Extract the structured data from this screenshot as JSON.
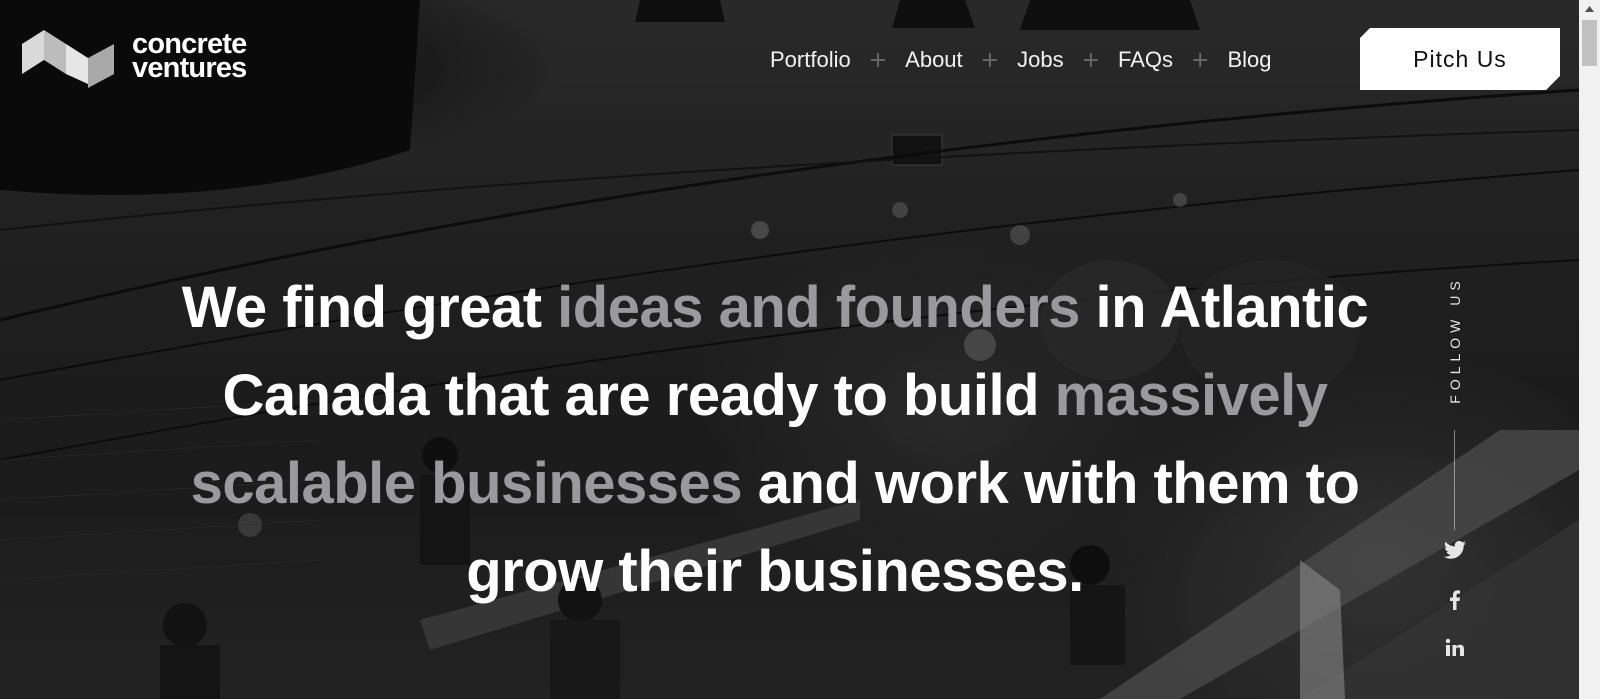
{
  "brand": {
    "name_line1": "concrete",
    "name_line2": "ventures"
  },
  "nav": {
    "items": [
      {
        "label": "Portfolio"
      },
      {
        "label": "About"
      },
      {
        "label": "Jobs"
      },
      {
        "label": "FAQs"
      },
      {
        "label": "Blog"
      }
    ],
    "separator": "+",
    "cta_label": "Pitch Us"
  },
  "hero": {
    "headline_parts": [
      {
        "text": "We find great ",
        "muted": false
      },
      {
        "text": "ideas and founders",
        "muted": true
      },
      {
        "text": " in Atlantic Canada that are ready to build ",
        "muted": false
      },
      {
        "text": "massively scalable businesses",
        "muted": true
      },
      {
        "text": " and work with them to grow their businesses.",
        "muted": false
      }
    ]
  },
  "social": {
    "label": "FOLLOW US",
    "items": [
      {
        "icon": "twitter-icon"
      },
      {
        "icon": "facebook-icon"
      },
      {
        "icon": "linkedin-icon"
      }
    ]
  },
  "colors": {
    "headline": "#ffffff",
    "headline_muted": "#9a9a9c",
    "cta_background": "#ffffff",
    "cta_text": "#111111"
  }
}
